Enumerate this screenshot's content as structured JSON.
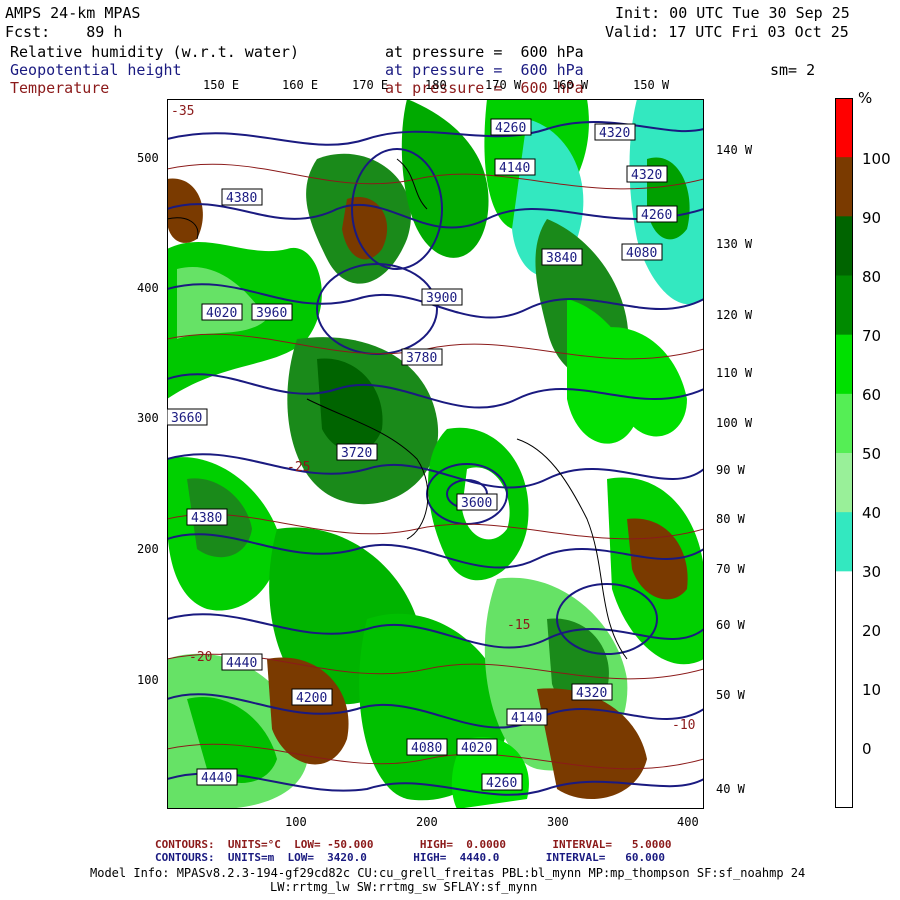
{
  "header": {
    "title": "AMPS 24-km MPAS",
    "forecast": "Fcst:    89 h",
    "init": "Init: 00 UTC Tue 30 Sep 25",
    "valid": "Valid: 17 UTC Fri 03 Oct 25",
    "smoothing": "sm= 2"
  },
  "fields": [
    {
      "name": "Relative humidity (w.r.t. water)",
      "level": "at pressure =  600 hPa",
      "color": "#000000"
    },
    {
      "name": "Geopotential height",
      "level": "at pressure =  600 hPa",
      "color": "#1a1a80"
    },
    {
      "name": "Temperature",
      "level": "at pressure =  600 hPa",
      "color": "#8b1a1a"
    }
  ],
  "map": {
    "top_lon_labels": [
      "150 E",
      "160 E",
      "170 E",
      "180",
      "170 W",
      "160 W",
      "150 W"
    ],
    "right_lon_labels": [
      "140 W",
      "130 W",
      "120 W",
      "110 W",
      "100 W",
      "90 W",
      "80 W",
      "70 W",
      "60 W",
      "50 W",
      "40 W"
    ],
    "x_ticks": [
      "100",
      "200",
      "300",
      "400"
    ],
    "y_ticks": [
      "500",
      "400",
      "300",
      "200",
      "100"
    ],
    "height_labels": [
      "4260",
      "4320",
      "4140",
      "4380",
      "4320",
      "4260",
      "4080",
      "4020",
      "3960",
      "3900",
      "3840",
      "3780",
      "3720",
      "3660",
      "3600",
      "4380",
      "4440",
      "4200",
      "4140",
      "4080",
      "4020",
      "4320",
      "4260",
      "4440"
    ],
    "temp_labels": [
      "-35",
      "-25",
      "-20",
      "-15",
      "-10"
    ]
  },
  "colorbar": {
    "unit": "%",
    "labels": [
      "100",
      "90",
      "80",
      "70",
      "60",
      "50",
      "40",
      "30",
      "20",
      "10",
      "0"
    ],
    "colors": [
      "#ff0000",
      "#7a3a00",
      "#006400",
      "#008a00",
      "#00e000",
      "#55ee55",
      "#99f099",
      "#33e8c0",
      "#ffffff",
      "#ffffff",
      "#ffffff",
      "#ffffff"
    ]
  },
  "footer": {
    "temp_contours": "CONTOURS:  UNITS=°C  LOW= -50.000       HIGH=  0.0000       INTERVAL=   5.0000",
    "height_contours": "CONTOURS:  UNITS=m  LOW=  3420.0       HIGH=  4440.0       INTERVAL=   60.000",
    "model_info_1": "Model Info: MPASv8.2.3-194-gf29cd82c CU:cu_grell_freitas PBL:bl_mynn MP:mp_thompson SF:sf_noahmp 24",
    "model_info_2": "LW:rrtmg_lw SW:rrtmg_sw SFLAY:sf_mynn"
  }
}
